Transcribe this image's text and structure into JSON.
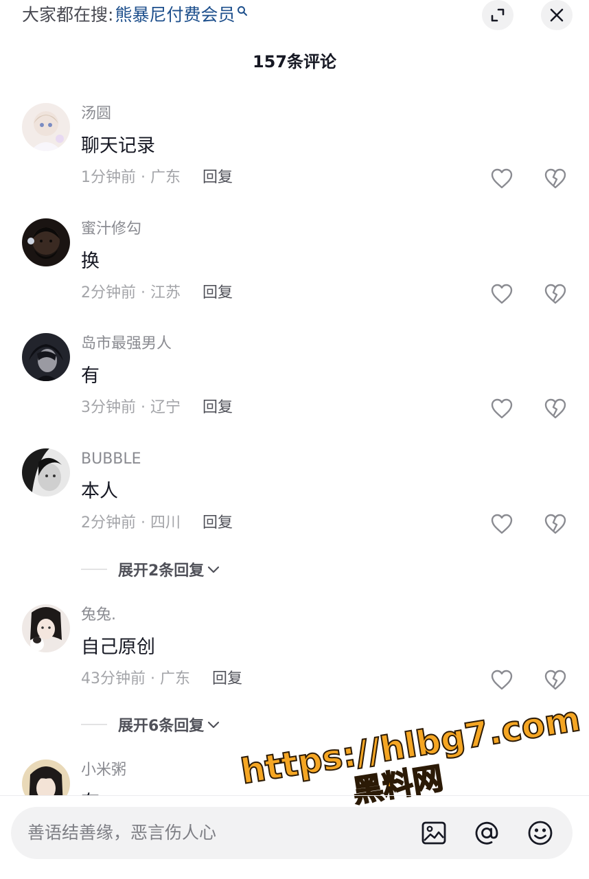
{
  "top_bar": {
    "search_prefix": "大家都在搜:",
    "search_term": "熊暴尼付费会员"
  },
  "comment_count_label": "157条评论",
  "comments": [
    {
      "username": "汤圆",
      "text": "聊天记录",
      "meta": "1分钟前 · 广东",
      "reply_label": "回复"
    },
    {
      "username": "蜜汁修勾",
      "text": "换",
      "meta": "2分钟前 · 江苏",
      "reply_label": "回复"
    },
    {
      "username": "岛市最强男人",
      "text": "有",
      "meta": "3分钟前 · 辽宁",
      "reply_label": "回复"
    },
    {
      "username": "BUBBLE",
      "text": "本人",
      "meta": "2分钟前 · 四川",
      "reply_label": "回复"
    },
    {
      "username": "兔兔.",
      "text": "自己原创",
      "meta": "43分钟前 · 广东",
      "reply_label": "回复"
    },
    {
      "username": "小米粥",
      "text": "有",
      "meta": "",
      "reply_label": ""
    }
  ],
  "expand_replies": [
    {
      "label": "展开2条回复"
    },
    {
      "label": "展开6条回复"
    }
  ],
  "watermark": {
    "url": "https://hlbg7.com",
    "name": "黑料网"
  },
  "input_bar": {
    "placeholder": "善语结善缘，恶言伤人心"
  },
  "icons": {
    "expand": "expand-icon",
    "close": "close-icon",
    "like": "heart-icon",
    "dislike": "broken-heart-icon",
    "image": "image-icon",
    "mention": "at-icon",
    "emoji": "emoji-icon"
  },
  "colors": {
    "search_term": "#1d4f8c",
    "watermark": "#f5a623",
    "meta_text": "#a3a4a8"
  }
}
